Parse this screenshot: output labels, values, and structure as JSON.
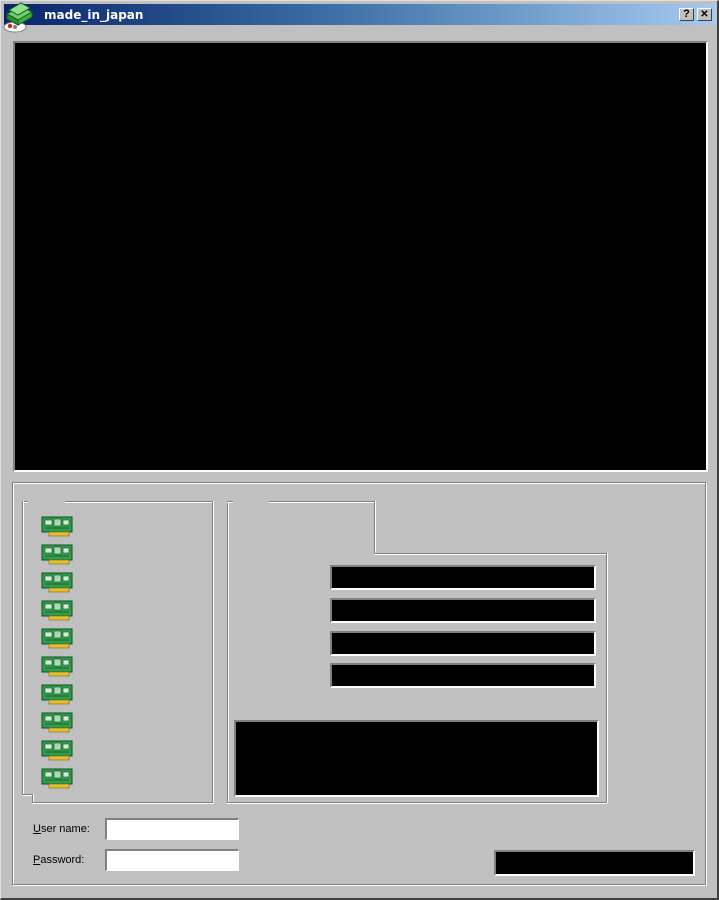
{
  "window": {
    "title": "made_in_japan",
    "help_label": "?",
    "close_label": "✕"
  },
  "icons": {
    "app": "green-disk-stack-icon",
    "board": "network-card-icon"
  },
  "board_list": {
    "item_count": 10
  },
  "login": {
    "username_label_prefix": "U",
    "username_label_rest": "ser name:",
    "username_value": "",
    "password_label_prefix": "P",
    "password_label_rest": "assword:",
    "password_value": ""
  },
  "colors": {
    "titlebar_start": "#0a246a",
    "titlebar_end": "#a6caf0",
    "face": "#c0c0c0",
    "display": "#000000"
  }
}
